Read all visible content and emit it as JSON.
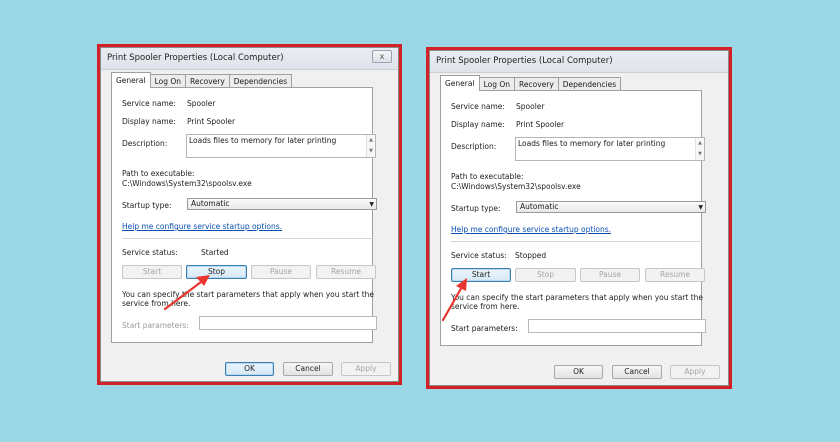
{
  "colors": {
    "background": "#9ad8e8",
    "frame": "#d42128",
    "annotation_arrow": "#e8352f"
  },
  "left_dialog": {
    "title": "Print Spooler Properties (Local Computer)",
    "close_label": "x",
    "tabs": [
      "General",
      "Log On",
      "Recovery",
      "Dependencies"
    ],
    "active_tab": "General",
    "service_name_label": "Service name:",
    "service_name_value": "Spooler",
    "display_name_label": "Display name:",
    "display_name_value": "Print Spooler",
    "description_label": "Description:",
    "description_value": "Loads files to memory for later printing",
    "path_label": "Path to executable:",
    "path_value": "C:\\Windows\\System32\\spoolsv.exe",
    "startup_type_label": "Startup type:",
    "startup_type_value": "Automatic",
    "help_link": "Help me configure service startup options.",
    "service_status_label": "Service status:",
    "service_status_value": "Started",
    "start_button": "Start",
    "stop_button": "Stop",
    "pause_button": "Pause",
    "resume_button": "Resume",
    "help_text": "You can specify the start parameters that apply when you start the service from here.",
    "start_parameters_label": "Start parameters:",
    "start_parameters_value": "",
    "ok_button": "OK",
    "cancel_button": "Cancel",
    "apply_button": "Apply",
    "scroll_up": "▲",
    "scroll_down": "▼",
    "dropdown_arrow": "▼"
  },
  "right_dialog": {
    "title": "Print Spooler Properties (Local Computer)",
    "tabs": [
      "General",
      "Log On",
      "Recovery",
      "Dependencies"
    ],
    "active_tab": "General",
    "service_name_label": "Service name:",
    "service_name_value": "Spooler",
    "display_name_label": "Display name:",
    "display_name_value": "Print Spooler",
    "description_label": "Description:",
    "description_value": "Loads files to memory for later printing",
    "path_label": "Path to executable:",
    "path_value": "C:\\Windows\\System32\\spoolsv.exe",
    "startup_type_label": "Startup type:",
    "startup_type_value": "Automatic",
    "help_link": "Help me configure service startup options.",
    "service_status_label": "Service status:",
    "service_status_value": "Stopped",
    "start_button": "Start",
    "stop_button": "Stop",
    "pause_button": "Pause",
    "resume_button": "Resume",
    "help_text": "You can specify the start parameters that apply when you start the service from here.",
    "start_parameters_label": "Start parameters:",
    "start_parameters_value": "",
    "ok_button": "OK",
    "cancel_button": "Cancel",
    "apply_button": "Apply",
    "scroll_up": "▲",
    "scroll_down": "▼",
    "dropdown_arrow": "▼"
  }
}
